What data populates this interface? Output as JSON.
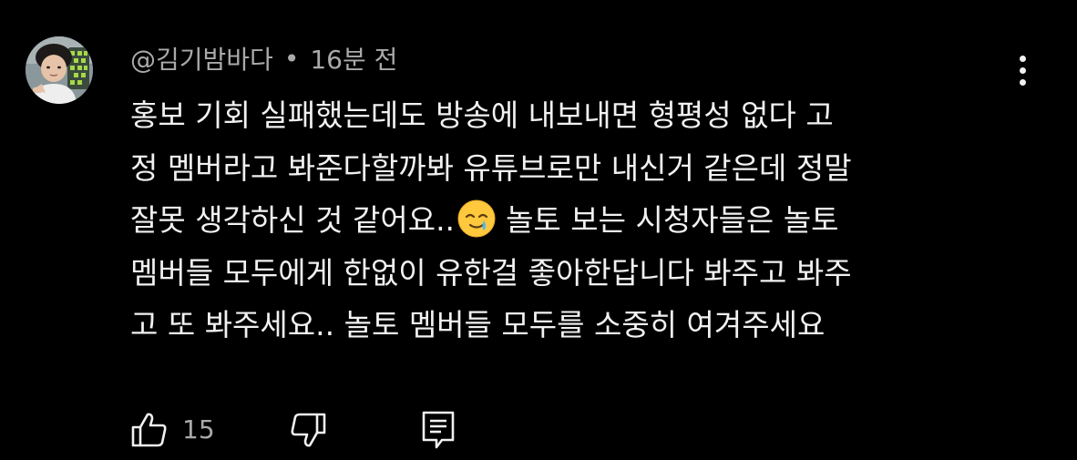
{
  "comment": {
    "author": "@김기밤바다",
    "separator": "•",
    "time": "16분 전",
    "text_lines": [
      "홍보 기회 실패했는데도 방송에 내보내면 형평성 없다 고",
      "정 멤버라고 봐준다할까봐 유튜브로만 내신거 같은데 정말",
      "잘못 생각하신 것 같어요..",
      "놀토 보는 시청자들은 놀토",
      "멤버들 모두에게 한없이 유한걸 좋아한답니다 봐주고 봐주",
      "고 또 봐주세요.. 놀토 멤버들 모두를 소중히 여겨주세요"
    ],
    "emoji": "smiling-face-with-tear",
    "likes": "15"
  },
  "icons": {
    "like": "thumbs-up-icon",
    "dislike": "thumbs-down-icon",
    "reply": "reply-icon",
    "more": "more-vertical-icon"
  },
  "colors": {
    "background": "#000000",
    "primary_text": "#f1f1f1",
    "secondary_text": "#aaaaaa"
  }
}
